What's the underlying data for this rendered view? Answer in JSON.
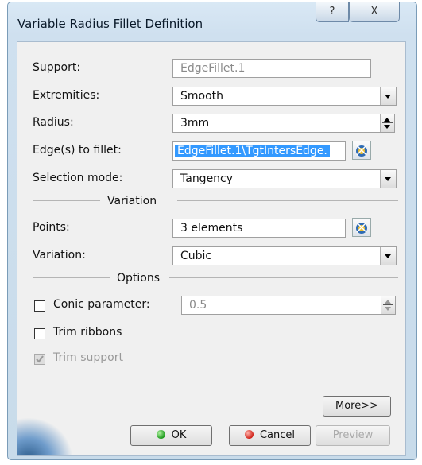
{
  "window": {
    "title": "Variable Radius Fillet Definition",
    "help_glyph": "?",
    "close_glyph": "X"
  },
  "form": {
    "support": {
      "label": "Support:",
      "value": "EdgeFillet.1"
    },
    "extremities": {
      "label": "Extremities:",
      "value": "Smooth"
    },
    "radius": {
      "label": "Radius:",
      "value": "3mm"
    },
    "edges": {
      "label": "Edge(s) to fillet:",
      "value": "EdgeFillet.1\\TgtIntersEdge."
    },
    "selection_mode": {
      "label": "Selection mode:",
      "value": "Tangency"
    },
    "variation_section": "Variation",
    "points": {
      "label": "Points:",
      "value": "3 elements"
    },
    "variation": {
      "label": "Variation:",
      "value": "Cubic"
    },
    "options_section": "Options",
    "conic": {
      "label": "Conic parameter:",
      "value": "0.5",
      "checked": false
    },
    "trim_ribbons": {
      "label": "Trim ribbons",
      "checked": false
    },
    "trim_support": {
      "label": "Trim support",
      "checked": true,
      "enabled": false
    }
  },
  "buttons": {
    "more": "More>>",
    "ok": "OK",
    "cancel": "Cancel",
    "preview": "Preview"
  }
}
